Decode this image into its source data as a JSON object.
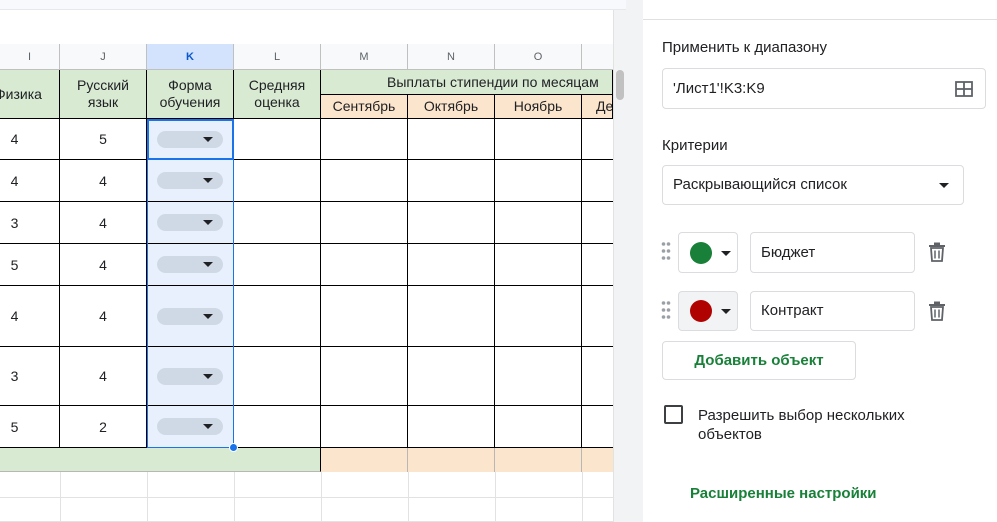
{
  "sheet": {
    "columns": [
      {
        "letter": "I",
        "selected": false
      },
      {
        "letter": "J",
        "selected": false
      },
      {
        "letter": "K",
        "selected": true
      },
      {
        "letter": "L",
        "selected": false
      },
      {
        "letter": "M",
        "selected": false
      },
      {
        "letter": "N",
        "selected": false
      },
      {
        "letter": "O",
        "selected": false
      }
    ],
    "headers": {
      "physics": "Физика",
      "russian_line1": "Русский",
      "russian_line2": "язык",
      "form_line1": "Форма",
      "form_line2": "обучения",
      "avg_line1": "Средняя",
      "avg_line2": "оценка",
      "payments": "Выплаты стипендии по месяцам",
      "months": [
        "Сентябрь",
        "Октябрь",
        "Ноябрь",
        "Де"
      ]
    },
    "rows": [
      {
        "physics": "4",
        "russian": "5"
      },
      {
        "physics": "4",
        "russian": "4"
      },
      {
        "physics": "3",
        "russian": "4"
      },
      {
        "physics": "5",
        "russian": "4"
      },
      {
        "physics": "4",
        "russian": "4"
      },
      {
        "physics": "3",
        "russian": "4"
      },
      {
        "physics": "5",
        "russian": "2"
      }
    ]
  },
  "panel": {
    "apply_range_label": "Применить к диапазону",
    "range_value": "'Лист1'!K3:K9",
    "criteria_label": "Критерии",
    "criteria_value": "Раскрывающийся список",
    "options": [
      {
        "value": "Бюджет",
        "color": "#188038"
      },
      {
        "value": "Контракт",
        "color": "#b10202"
      }
    ],
    "add_item_label": "Добавить объект",
    "allow_multiple_label": "Разрешить выбор нескольких объектов",
    "allow_multiple_checked": false,
    "advanced_label": "Расширенные настройки"
  },
  "colors": {
    "accent_green": "#188038",
    "selection_blue": "#1a73e8",
    "header_green": "#d9ead3",
    "header_orange": "#fce5cd"
  }
}
